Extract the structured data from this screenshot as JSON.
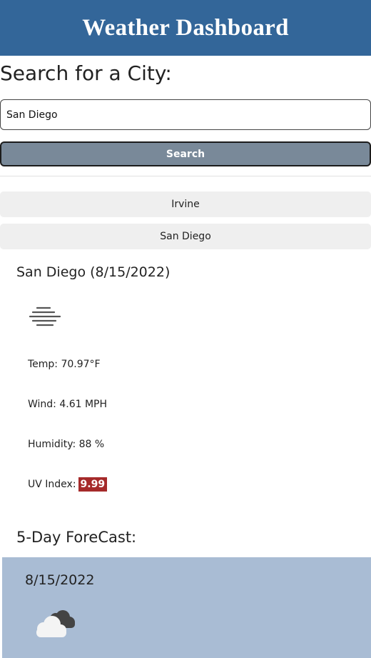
{
  "header": {
    "title": "Weather Dashboard"
  },
  "search": {
    "heading": "Search for a City:",
    "value": "San Diego",
    "button_label": "Search"
  },
  "history": [
    "Irvine",
    "San Diego"
  ],
  "current": {
    "title": "San Diego (8/15/2022)",
    "icon": "mist-icon",
    "temp": "Temp: 70.97°F",
    "wind": "Wind: 4.61 MPH",
    "humidity": "Humidity: 88 %",
    "uv_label": "UV Index:",
    "uv_value": "9.99",
    "uv_color": "#a52a2a"
  },
  "forecast": {
    "heading": "5-Day ForeCast:",
    "days": [
      {
        "date": "8/15/2022",
        "icon": "broken-clouds-icon"
      }
    ]
  },
  "colors": {
    "header": "#336699",
    "search_button": "#798999",
    "forecast_card": "#a9bcd4"
  }
}
